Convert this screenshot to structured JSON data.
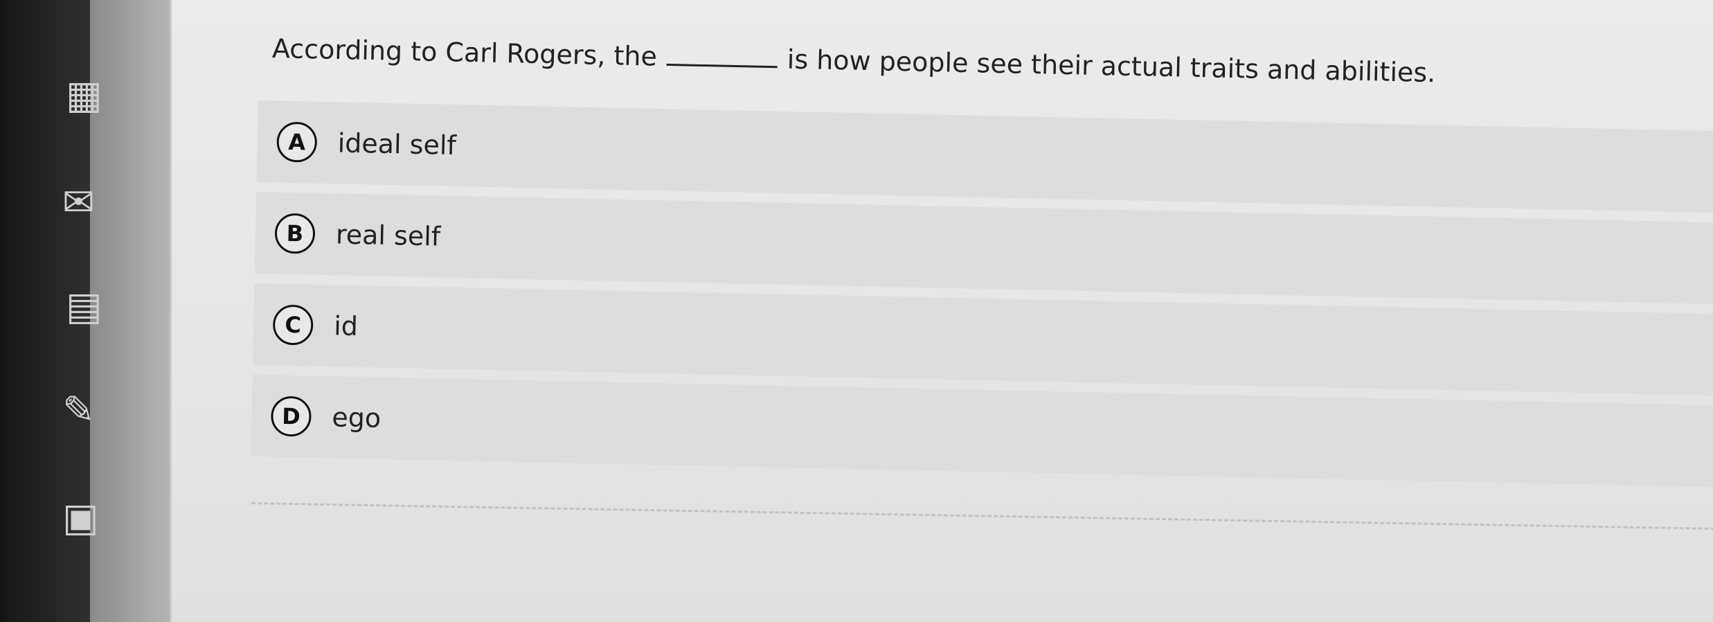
{
  "question": {
    "before_blank": "According to Carl Rogers, the",
    "after_blank": "is how people see their actual traits and abilities."
  },
  "options": [
    {
      "letter": "A",
      "text": "ideal self"
    },
    {
      "letter": "B",
      "text": "real self"
    },
    {
      "letter": "C",
      "text": "id"
    },
    {
      "letter": "D",
      "text": "ego"
    }
  ],
  "sidebar_icons": [
    "calculator-icon",
    "mail-icon",
    "notes-icon",
    "pen-icon",
    "edit-icon"
  ]
}
